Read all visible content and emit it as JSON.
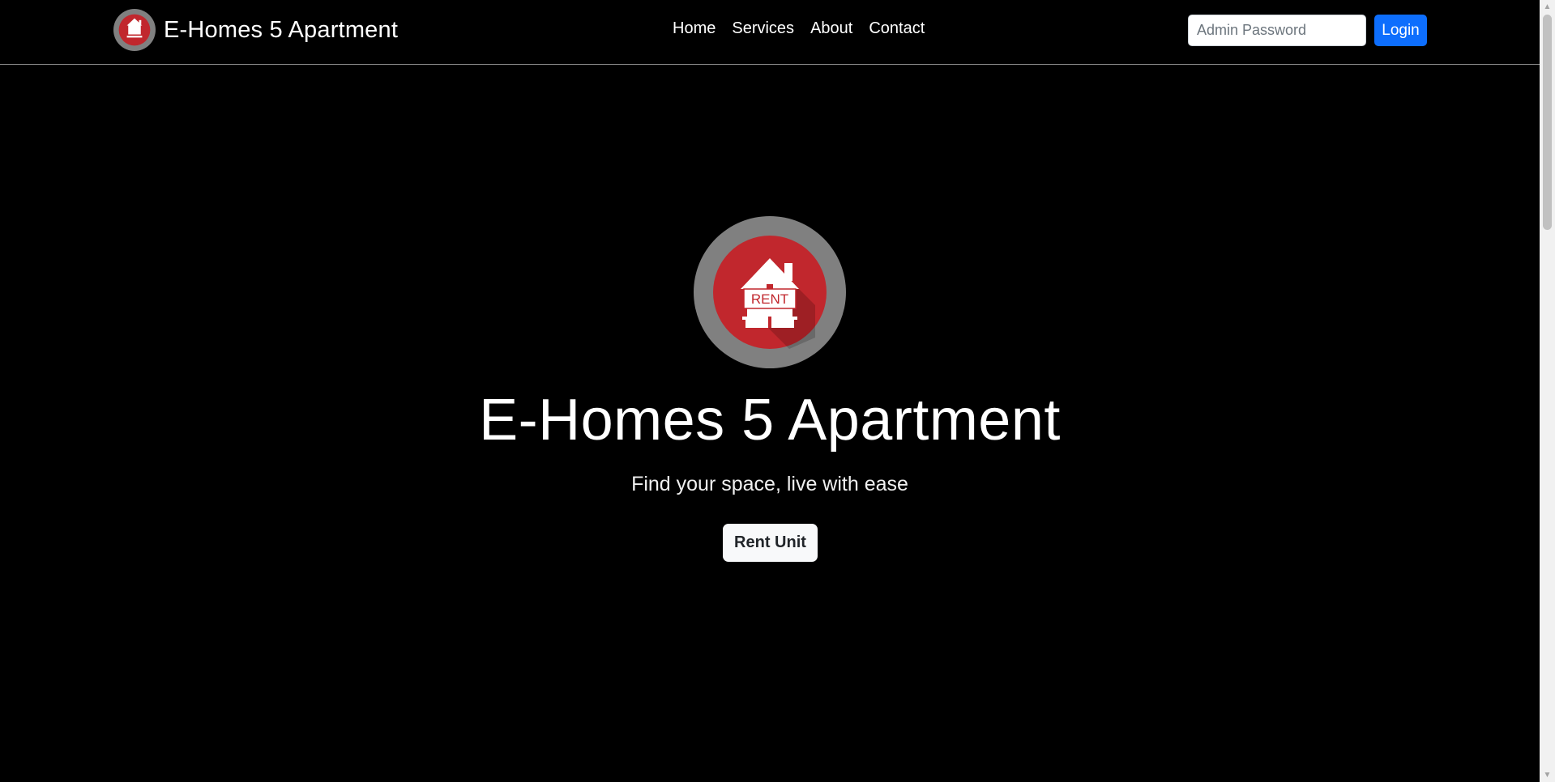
{
  "navbar": {
    "brand_name": "E-Homes 5 Apartment",
    "links": [
      {
        "label": "Home"
      },
      {
        "label": "Services"
      },
      {
        "label": "About"
      },
      {
        "label": "Contact"
      }
    ],
    "password_placeholder": "Admin Password",
    "login_label": "Login"
  },
  "hero": {
    "logo_icon": "rent-house-icon",
    "logo_text": "RENT",
    "title": "E-Homes 5 Apartment",
    "subtitle": "Find your space, live with ease",
    "cta_label": "Rent Unit"
  },
  "colors": {
    "background": "#000000",
    "primary_button": "#0d6efd",
    "logo_red": "#c1272d",
    "logo_ring": "#808080"
  }
}
